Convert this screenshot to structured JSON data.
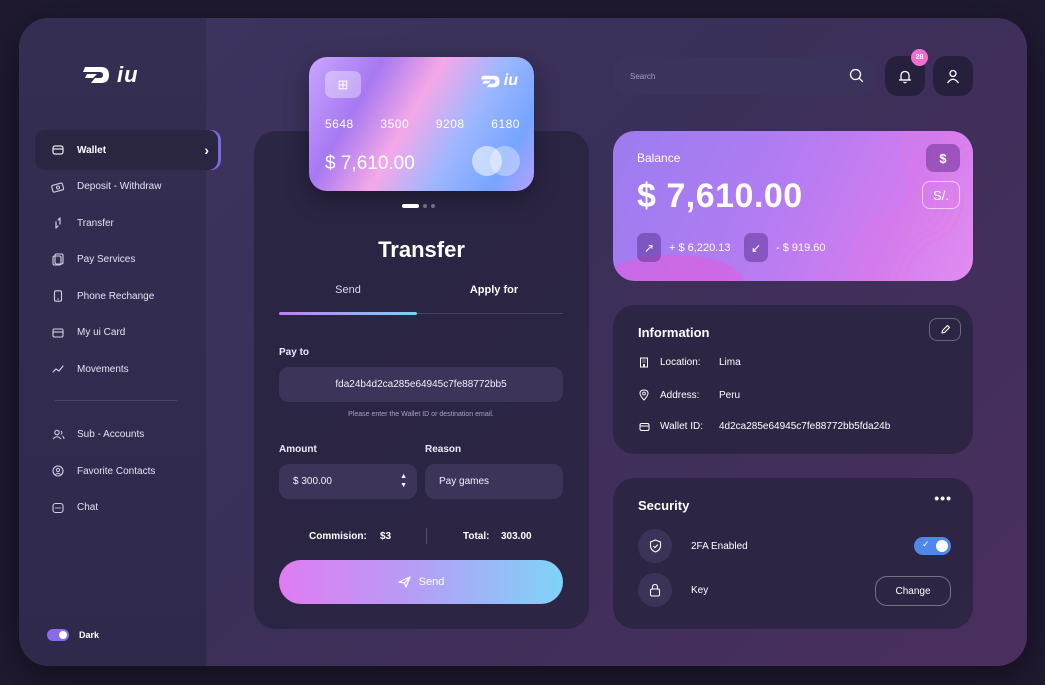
{
  "brand": {
    "logo_text": "iu"
  },
  "sidebar": {
    "items": [
      {
        "label": "Wallet",
        "icon": "wallet-icon"
      },
      {
        "label": "Deposit - Withdraw",
        "icon": "deposit-icon"
      },
      {
        "label": "Transfer",
        "icon": "transfer-icon"
      },
      {
        "label": "Pay Services",
        "icon": "document-icon"
      },
      {
        "label": "Phone Rechange",
        "icon": "phone-icon"
      },
      {
        "label": "My ui Card",
        "icon": "card-icon"
      },
      {
        "label": "Movements",
        "icon": "trend-icon"
      }
    ],
    "secondary": [
      {
        "label": "Sub - Accounts",
        "icon": "users-icon"
      },
      {
        "label": "Favorite Contacts",
        "icon": "contacts-icon"
      },
      {
        "label": "Chat",
        "icon": "chat-icon"
      }
    ],
    "dark_label": "Dark"
  },
  "card": {
    "brand": "iu",
    "numbers": [
      "5648",
      "3500",
      "9208",
      "6180"
    ],
    "amount": "$ 7,610.00"
  },
  "transfer": {
    "title": "Transfer",
    "tabs": [
      "Send",
      "Apply for"
    ],
    "pay_to_label": "Pay to",
    "pay_to_value": "fda24b4d2ca285e64945c7fe88772bb5",
    "helper": "Please enter the Wallet ID or destination email.",
    "amount_label": "Amount",
    "amount_value": "$ 300.00",
    "reason_label": "Reason",
    "reason_value": "Pay games",
    "commission_label": "Commision:",
    "commission_value": "$3",
    "total_label": "Total:",
    "total_value": "303.00",
    "send_label": "Send"
  },
  "header": {
    "search_placeholder": "Search",
    "notifications_count": "28"
  },
  "balance": {
    "label": "Balance",
    "amount": "$ 7,610.00",
    "currency_usd": "$",
    "currency_pen": "S/.",
    "income": "+ $ 6,220.13",
    "outcome": "- $ 919.60"
  },
  "information": {
    "title": "Information",
    "rows": [
      {
        "label": "Location:",
        "value": "Lima"
      },
      {
        "label": "Address:",
        "value": "Peru"
      },
      {
        "label": "Wallet ID:",
        "value": "4d2ca285e64945c7fe88772bb5fda24b"
      }
    ]
  },
  "security": {
    "title": "Security",
    "twofa_label": "2FA Enabled",
    "key_label": "Key",
    "change_label": "Change"
  },
  "colors": {
    "accent_purple": "#a779f2",
    "accent_pink": "#f06fd1",
    "accent_blue": "#7fd3f8"
  }
}
